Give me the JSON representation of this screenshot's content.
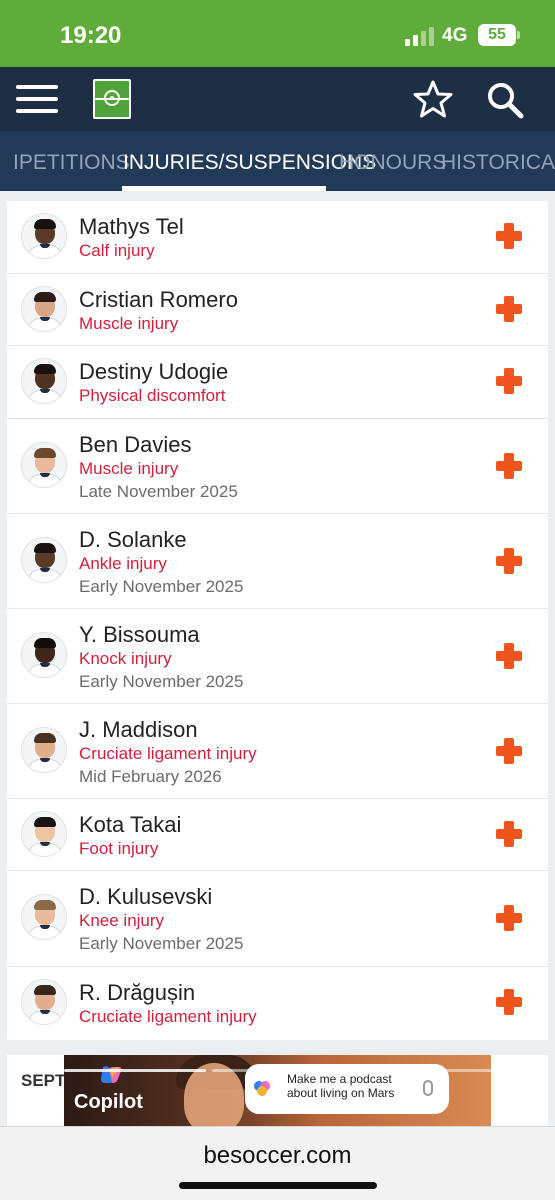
{
  "status_bar": {
    "time": "19:20",
    "network": "4G",
    "battery": "55"
  },
  "app_bar": {
    "icons": [
      "menu-icon",
      "pitch-logo-icon",
      "star-icon",
      "search-icon"
    ]
  },
  "tabs": [
    {
      "label": "COMPETITIONS",
      "visible_label": "IPETITIONS",
      "active": false
    },
    {
      "label": "INJURIES/SUSPENSIONS",
      "active": true
    },
    {
      "label": "HONOURS",
      "active": false
    },
    {
      "label": "HISTORICAL",
      "active": false
    }
  ],
  "injuries": [
    {
      "name": "Mathys Tel",
      "injury": "Calf injury",
      "return": ""
    },
    {
      "name": "Cristian Romero",
      "injury": "Muscle injury",
      "return": ""
    },
    {
      "name": "Destiny Udogie",
      "injury": "Physical discomfort",
      "return": ""
    },
    {
      "name": "Ben Davies",
      "injury": "Muscle injury",
      "return": "Late November 2025"
    },
    {
      "name": "D. Solanke",
      "injury": "Ankle injury",
      "return": "Early November 2025"
    },
    {
      "name": "Y. Bissouma",
      "injury": "Knock injury",
      "return": "Early November 2025"
    },
    {
      "name": "J. Maddison",
      "injury": "Cruciate ligament injury",
      "return": "Mid February 2026"
    },
    {
      "name": "Kota Takai",
      "injury": "Foot injury",
      "return": ""
    },
    {
      "name": "D. Kulusevski",
      "injury": "Knee injury",
      "return": "Early November 2025"
    },
    {
      "name": "R. Drăgușin",
      "injury": "Cruciate ligament injury",
      "return": ""
    }
  ],
  "next_section": {
    "title_visible": "SEPT"
  },
  "ad": {
    "brand": "Copilot",
    "prompt": "Make me a podcast about living on Mars"
  },
  "browser": {
    "url": "besoccer.com"
  },
  "colors": {
    "status_green": "#5fac3a",
    "header_navy": "#1d2e45",
    "tabs_navy": "#223a58",
    "injury_red": "#d21f3c",
    "cross_orange": "#f0541e"
  }
}
